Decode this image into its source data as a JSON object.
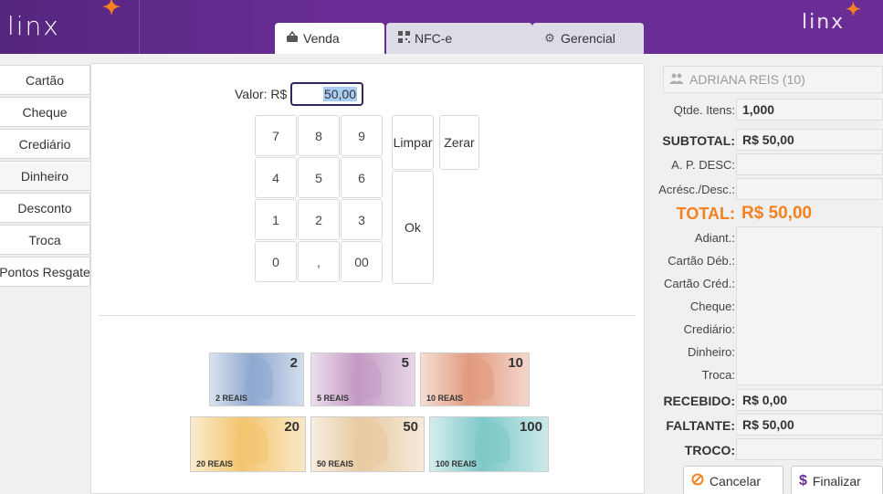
{
  "header": {
    "logo_left": "linx",
    "logo_right": "linx",
    "tabs": [
      {
        "label": "Venda",
        "icon": "basket-icon",
        "active": true
      },
      {
        "label": "NFC-e",
        "icon": "qrcode-icon",
        "active": false
      },
      {
        "label": "Gerencial",
        "icon": "gears-icon",
        "active": false
      }
    ]
  },
  "sidebar": {
    "items": [
      {
        "label": "Cartão"
      },
      {
        "label": "Cheque"
      },
      {
        "label": "Crediário"
      },
      {
        "label": "Dinheiro",
        "active": true
      },
      {
        "label": "Desconto"
      },
      {
        "label": "Troca"
      },
      {
        "label": "Pontos Resgate"
      }
    ]
  },
  "main": {
    "valor_label": "Valor: R$",
    "valor_value": "50,00",
    "keys": [
      "7",
      "8",
      "9",
      "4",
      "5",
      "6",
      "1",
      "2",
      "3",
      "0",
      ",",
      "00"
    ],
    "limpar_label": "Limpar",
    "zerar_label": "Zerar",
    "ok_label": "Ok",
    "banknotes": [
      {
        "value": "2",
        "small": "2 REAIS",
        "color": "#8fa8d0"
      },
      {
        "value": "5",
        "small": "5 REAIS",
        "color": "#c49ac4"
      },
      {
        "value": "10",
        "small": "10 REAIS",
        "color": "#e29a7e"
      },
      {
        "value": "20",
        "small": "20 REAIS",
        "color": "#f2c56e"
      },
      {
        "value": "50",
        "small": "50 REAIS",
        "color": "#e8c9a0"
      },
      {
        "value": "100",
        "small": "100 REAIS",
        "color": "#7ec8c8"
      }
    ]
  },
  "summary": {
    "customer": "ADRIANA REIS (10)",
    "qtde_label": "Qtde. Itens:",
    "qtde_value": "1,000",
    "subtotal_label": "SUBTOTAL:",
    "subtotal_value": "R$ 50,00",
    "ap_desc_label": "A. P. DESC:",
    "acresc_label": "Acrésc./Desc.:",
    "total_label": "TOTAL:",
    "total_value": "R$ 50,00",
    "payments": [
      "Adiant.:",
      "Cartão Déb.:",
      "Cartão Créd.:",
      "Cheque:",
      "Crediário:",
      "Dinheiro:",
      "Troca:"
    ],
    "recebido_label": "RECEBIDO:",
    "recebido_value": "R$ 0,00",
    "faltante_label": "FALTANTE:",
    "faltante_value": "R$ 50,00",
    "troco_label": "TROCO:",
    "cancelar_label": "Cancelar",
    "finalizar_label": "Finalizar"
  },
  "colors": {
    "header": "#6a2d96",
    "accent": "#f58220",
    "input_border": "#302660"
  }
}
